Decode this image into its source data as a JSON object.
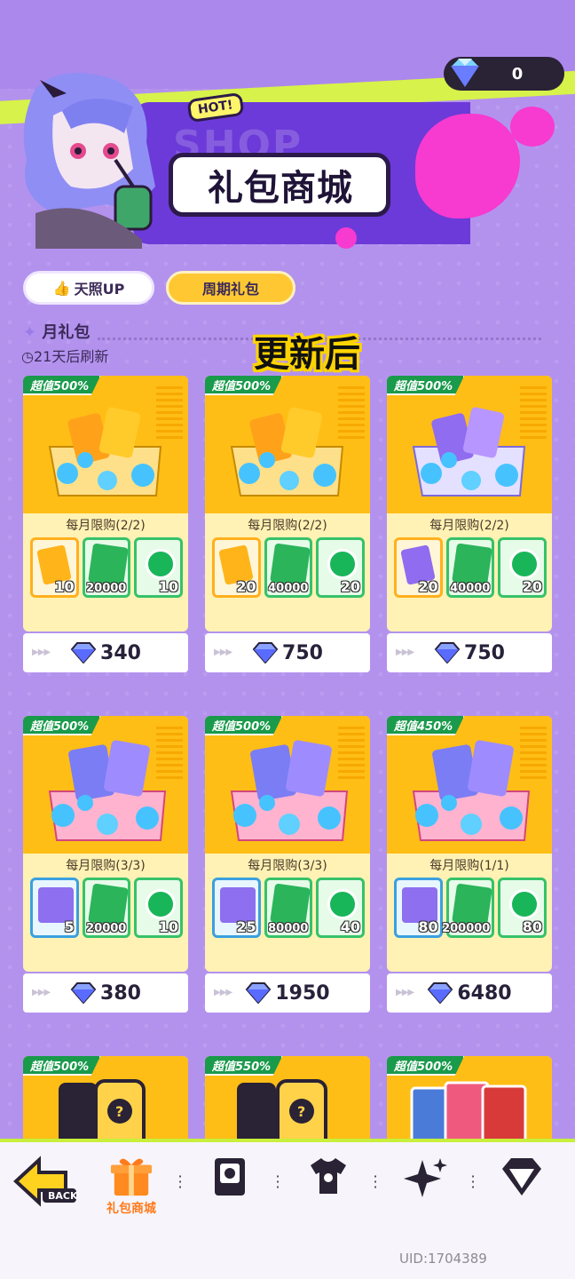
{
  "header": {
    "title": "礼包商城",
    "ghost_text": "SHOP",
    "hot_tag": "HOT!",
    "currency_value": "0"
  },
  "tabs": [
    {
      "label": "天照UP",
      "selected": false
    },
    {
      "label": "周期礼包",
      "selected": true
    }
  ],
  "section": {
    "title": "月礼包",
    "refresh": "21天后刷新"
  },
  "overlay_label": "更新后",
  "packs": [
    {
      "ribbon": "超值500%",
      "limit": "每月限购(2/2)",
      "items": [
        {
          "qty": "10"
        },
        {
          "qty": "20000"
        },
        {
          "qty": "10"
        }
      ],
      "price": "340"
    },
    {
      "ribbon": "超值500%",
      "limit": "每月限购(2/2)",
      "items": [
        {
          "qty": "20"
        },
        {
          "qty": "40000"
        },
        {
          "qty": "20"
        }
      ],
      "price": "750"
    },
    {
      "ribbon": "超值500%",
      "limit": "每月限购(2/2)",
      "items": [
        {
          "qty": "20"
        },
        {
          "qty": "40000"
        },
        {
          "qty": "20"
        }
      ],
      "price": "750"
    },
    {
      "ribbon": "超值500%",
      "limit": "每月限购(3/3)",
      "items": [
        {
          "qty": "5"
        },
        {
          "qty": "20000"
        },
        {
          "qty": "10"
        }
      ],
      "price": "380"
    },
    {
      "ribbon": "超值500%",
      "limit": "每月限购(3/3)",
      "items": [
        {
          "qty": "25"
        },
        {
          "qty": "80000"
        },
        {
          "qty": "40"
        }
      ],
      "price": "1950"
    },
    {
      "ribbon": "超值450%",
      "limit": "每月限购(1/1)",
      "items": [
        {
          "qty": "80"
        },
        {
          "qty": "200000"
        },
        {
          "qty": "80"
        }
      ],
      "price": "6480"
    },
    {
      "ribbon": "超值500%"
    },
    {
      "ribbon": "超值550%"
    },
    {
      "ribbon": "超值500%"
    }
  ],
  "bottom_nav": {
    "back_label": "BACK",
    "active_label": "礼包商城"
  },
  "uid": "UID:1704389",
  "colors": {
    "background": "#b392ee",
    "card_yellow": "#ffbe16",
    "ribbon_green": "#1a9a4b",
    "accent_orange": "#ff7a1a",
    "banner_purple": "#6c3ad8",
    "splash_pink": "#f73ad0"
  },
  "icons": [
    "gem-icon",
    "thumb-up-icon",
    "star-icon",
    "clock-icon",
    "ticket-icon",
    "cash-icon",
    "token-icon",
    "back-arrow-icon",
    "gift-icon",
    "card-icon",
    "shirt-icon",
    "sparkle-icon",
    "diamond-icon"
  ]
}
